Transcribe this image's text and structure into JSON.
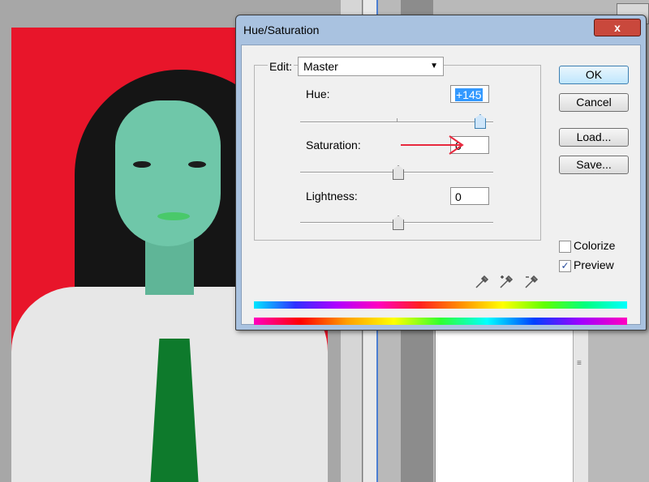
{
  "dialog": {
    "title": "Hue/Saturation",
    "close_label": "x",
    "edit_label": "Edit:",
    "edit_value": "Master",
    "hue": {
      "label": "Hue:",
      "value": "+145",
      "position": 0.9
    },
    "saturation": {
      "label": "Saturation:",
      "value": "0",
      "position": 0.5
    },
    "lightness": {
      "label": "Lightness:",
      "value": "0",
      "position": 0.5
    },
    "buttons": {
      "ok": "OK",
      "cancel": "Cancel",
      "load": "Load...",
      "save": "Save..."
    },
    "colorize": {
      "label": "Colorize",
      "checked": false
    },
    "preview": {
      "label": "Preview",
      "checked": true
    }
  },
  "colors": {
    "annotation_arrow": "#e8293e",
    "photo_background": "#e8152a"
  },
  "icons": [
    "eyedropper-icon",
    "eyedropper-plus-icon",
    "eyedropper-minus-icon",
    "close-icon"
  ]
}
